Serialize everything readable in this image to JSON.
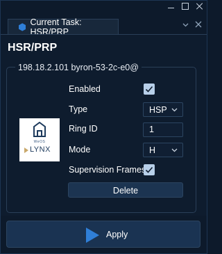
{
  "tab": {
    "label": "Current Task: HSR/PRP"
  },
  "page_title": "HSR/PRP",
  "device": {
    "label": "198.18.2.101  byron-53-2c-e0@"
  },
  "logo": {
    "brand_top": "WeOS",
    "brand_bottom": "LYNX"
  },
  "form": {
    "enabled": {
      "label": "Enabled",
      "checked": true
    },
    "type": {
      "label": "Type",
      "value": "HSP"
    },
    "ring_id": {
      "label": "Ring ID",
      "value": "1"
    },
    "mode": {
      "label": "Mode",
      "value": "H"
    },
    "supervision": {
      "label": "Supervision Frames",
      "checked": true
    },
    "delete_label": "Delete"
  },
  "apply_label": "Apply",
  "colors": {
    "accent": "#2f7fd8",
    "check_fill": "#b7cfe9",
    "background": "#0d1a2b"
  }
}
